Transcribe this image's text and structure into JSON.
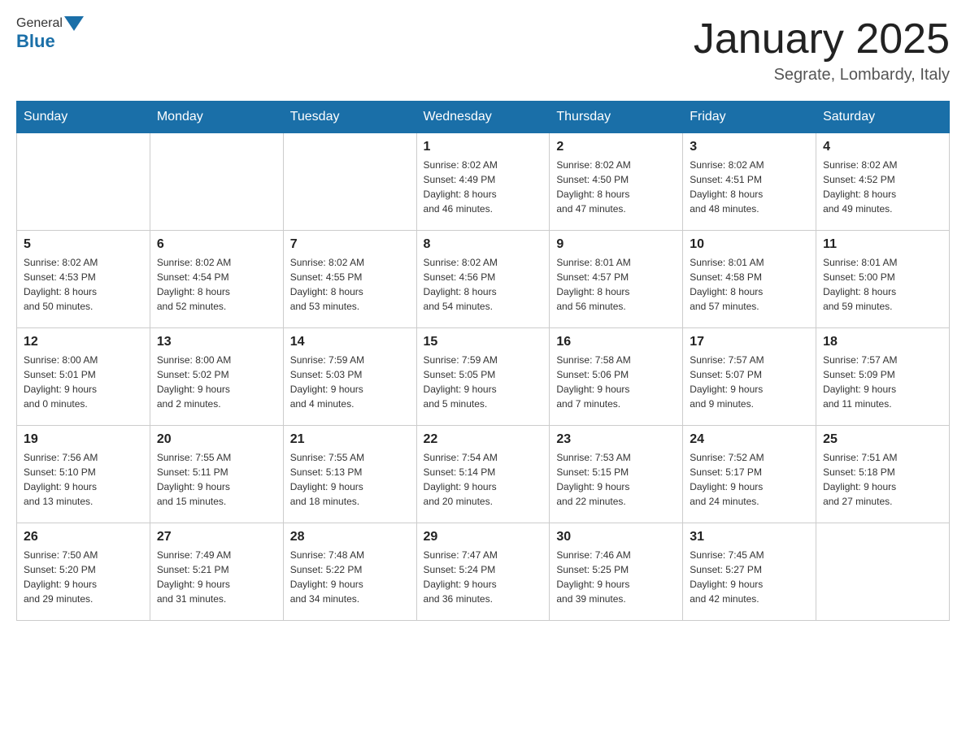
{
  "header": {
    "logo": {
      "text_general": "General",
      "text_blue": "Blue"
    },
    "title": "January 2025",
    "subtitle": "Segrate, Lombardy, Italy"
  },
  "weekdays": [
    "Sunday",
    "Monday",
    "Tuesday",
    "Wednesday",
    "Thursday",
    "Friday",
    "Saturday"
  ],
  "weeks": [
    [
      {
        "day": "",
        "info": ""
      },
      {
        "day": "",
        "info": ""
      },
      {
        "day": "",
        "info": ""
      },
      {
        "day": "1",
        "info": "Sunrise: 8:02 AM\nSunset: 4:49 PM\nDaylight: 8 hours\nand 46 minutes."
      },
      {
        "day": "2",
        "info": "Sunrise: 8:02 AM\nSunset: 4:50 PM\nDaylight: 8 hours\nand 47 minutes."
      },
      {
        "day": "3",
        "info": "Sunrise: 8:02 AM\nSunset: 4:51 PM\nDaylight: 8 hours\nand 48 minutes."
      },
      {
        "day": "4",
        "info": "Sunrise: 8:02 AM\nSunset: 4:52 PM\nDaylight: 8 hours\nand 49 minutes."
      }
    ],
    [
      {
        "day": "5",
        "info": "Sunrise: 8:02 AM\nSunset: 4:53 PM\nDaylight: 8 hours\nand 50 minutes."
      },
      {
        "day": "6",
        "info": "Sunrise: 8:02 AM\nSunset: 4:54 PM\nDaylight: 8 hours\nand 52 minutes."
      },
      {
        "day": "7",
        "info": "Sunrise: 8:02 AM\nSunset: 4:55 PM\nDaylight: 8 hours\nand 53 minutes."
      },
      {
        "day": "8",
        "info": "Sunrise: 8:02 AM\nSunset: 4:56 PM\nDaylight: 8 hours\nand 54 minutes."
      },
      {
        "day": "9",
        "info": "Sunrise: 8:01 AM\nSunset: 4:57 PM\nDaylight: 8 hours\nand 56 minutes."
      },
      {
        "day": "10",
        "info": "Sunrise: 8:01 AM\nSunset: 4:58 PM\nDaylight: 8 hours\nand 57 minutes."
      },
      {
        "day": "11",
        "info": "Sunrise: 8:01 AM\nSunset: 5:00 PM\nDaylight: 8 hours\nand 59 minutes."
      }
    ],
    [
      {
        "day": "12",
        "info": "Sunrise: 8:00 AM\nSunset: 5:01 PM\nDaylight: 9 hours\nand 0 minutes."
      },
      {
        "day": "13",
        "info": "Sunrise: 8:00 AM\nSunset: 5:02 PM\nDaylight: 9 hours\nand 2 minutes."
      },
      {
        "day": "14",
        "info": "Sunrise: 7:59 AM\nSunset: 5:03 PM\nDaylight: 9 hours\nand 4 minutes."
      },
      {
        "day": "15",
        "info": "Sunrise: 7:59 AM\nSunset: 5:05 PM\nDaylight: 9 hours\nand 5 minutes."
      },
      {
        "day": "16",
        "info": "Sunrise: 7:58 AM\nSunset: 5:06 PM\nDaylight: 9 hours\nand 7 minutes."
      },
      {
        "day": "17",
        "info": "Sunrise: 7:57 AM\nSunset: 5:07 PM\nDaylight: 9 hours\nand 9 minutes."
      },
      {
        "day": "18",
        "info": "Sunrise: 7:57 AM\nSunset: 5:09 PM\nDaylight: 9 hours\nand 11 minutes."
      }
    ],
    [
      {
        "day": "19",
        "info": "Sunrise: 7:56 AM\nSunset: 5:10 PM\nDaylight: 9 hours\nand 13 minutes."
      },
      {
        "day": "20",
        "info": "Sunrise: 7:55 AM\nSunset: 5:11 PM\nDaylight: 9 hours\nand 15 minutes."
      },
      {
        "day": "21",
        "info": "Sunrise: 7:55 AM\nSunset: 5:13 PM\nDaylight: 9 hours\nand 18 minutes."
      },
      {
        "day": "22",
        "info": "Sunrise: 7:54 AM\nSunset: 5:14 PM\nDaylight: 9 hours\nand 20 minutes."
      },
      {
        "day": "23",
        "info": "Sunrise: 7:53 AM\nSunset: 5:15 PM\nDaylight: 9 hours\nand 22 minutes."
      },
      {
        "day": "24",
        "info": "Sunrise: 7:52 AM\nSunset: 5:17 PM\nDaylight: 9 hours\nand 24 minutes."
      },
      {
        "day": "25",
        "info": "Sunrise: 7:51 AM\nSunset: 5:18 PM\nDaylight: 9 hours\nand 27 minutes."
      }
    ],
    [
      {
        "day": "26",
        "info": "Sunrise: 7:50 AM\nSunset: 5:20 PM\nDaylight: 9 hours\nand 29 minutes."
      },
      {
        "day": "27",
        "info": "Sunrise: 7:49 AM\nSunset: 5:21 PM\nDaylight: 9 hours\nand 31 minutes."
      },
      {
        "day": "28",
        "info": "Sunrise: 7:48 AM\nSunset: 5:22 PM\nDaylight: 9 hours\nand 34 minutes."
      },
      {
        "day": "29",
        "info": "Sunrise: 7:47 AM\nSunset: 5:24 PM\nDaylight: 9 hours\nand 36 minutes."
      },
      {
        "day": "30",
        "info": "Sunrise: 7:46 AM\nSunset: 5:25 PM\nDaylight: 9 hours\nand 39 minutes."
      },
      {
        "day": "31",
        "info": "Sunrise: 7:45 AM\nSunset: 5:27 PM\nDaylight: 9 hours\nand 42 minutes."
      },
      {
        "day": "",
        "info": ""
      }
    ]
  ]
}
